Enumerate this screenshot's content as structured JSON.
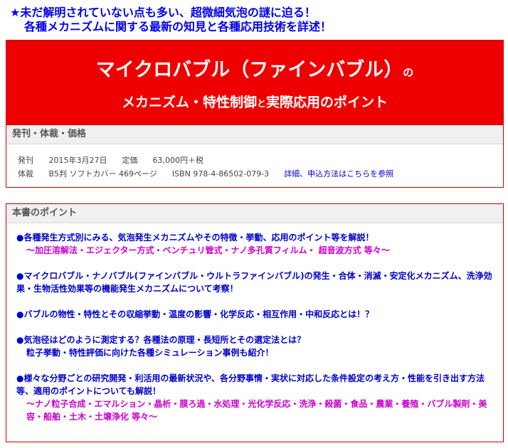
{
  "headline": {
    "line1": "★未だ解明されていない点も多い、超微細気泡の謎に迫る！",
    "line2": "各種メカニズムに関する最新の知見と各種応用技術を詳述！"
  },
  "hero": {
    "title_main": "マイクロバブル（ファインバブル）",
    "title_suffix": "の",
    "subtitle_a": "メカニズム・特性制御",
    "subtitle_b": "と",
    "subtitle_c": "実際応用のポイント"
  },
  "info": {
    "heading": "発刊・体裁・価格",
    "row1": {
      "label": "発刊",
      "date": "2015年3月27日",
      "price_label": "定価",
      "price": "63,000円＋税"
    },
    "row2": {
      "label": "体裁",
      "format": "B5判 ソフトカバー 469ページ",
      "isbn": "ISBN 978-4-86502-079-3",
      "link": "詳細、申込方法はこちらを参照"
    }
  },
  "points": {
    "heading": "本書のポイント",
    "items": [
      {
        "main": "●各種発生方式別にみる、気泡発生メカニズムやその特徴・挙動、応用のポイント等を解説！",
        "sub": "～加圧溶解法・エジェクター方式・ベンチュリ管式・ナノ多孔質フィルム・ 超音波方式 等々～"
      },
      {
        "main": "●マイクロバブル・ナノバブル(ファインバブル・ウルトラファインバブル)の発生・合体・消滅・安定化メカニズム、洗浄効果・生物活性効果等の機能発生メカニズムについて考察！"
      },
      {
        "main": "●バブルの物性・特性とその収縮挙動・温度の影響・化学反応・相互作用・中和反応とは！？"
      },
      {
        "main": "●気泡径はどのように測定する？各種法の原理・長短所とその選定法とは？",
        "sub_blue": "粒子挙動・特性評価に向けた各種シミュレーション事例も紹介！"
      },
      {
        "main": "●様々な分野ごとの研究開発・利活用の最新状況や、各分野事情・実状に対応した条件設定の考え方・性能を引き出す方法等、適用のポイントについても解説！",
        "sub": "～ナノ粒子合成・エマルション・晶析・膜ろ過・水処理・光化学反応・洗浄・殺菌・食品・農業・養殖・バブル製剤・美容・船舶・土木・土壌浄化 等々～"
      }
    ]
  }
}
